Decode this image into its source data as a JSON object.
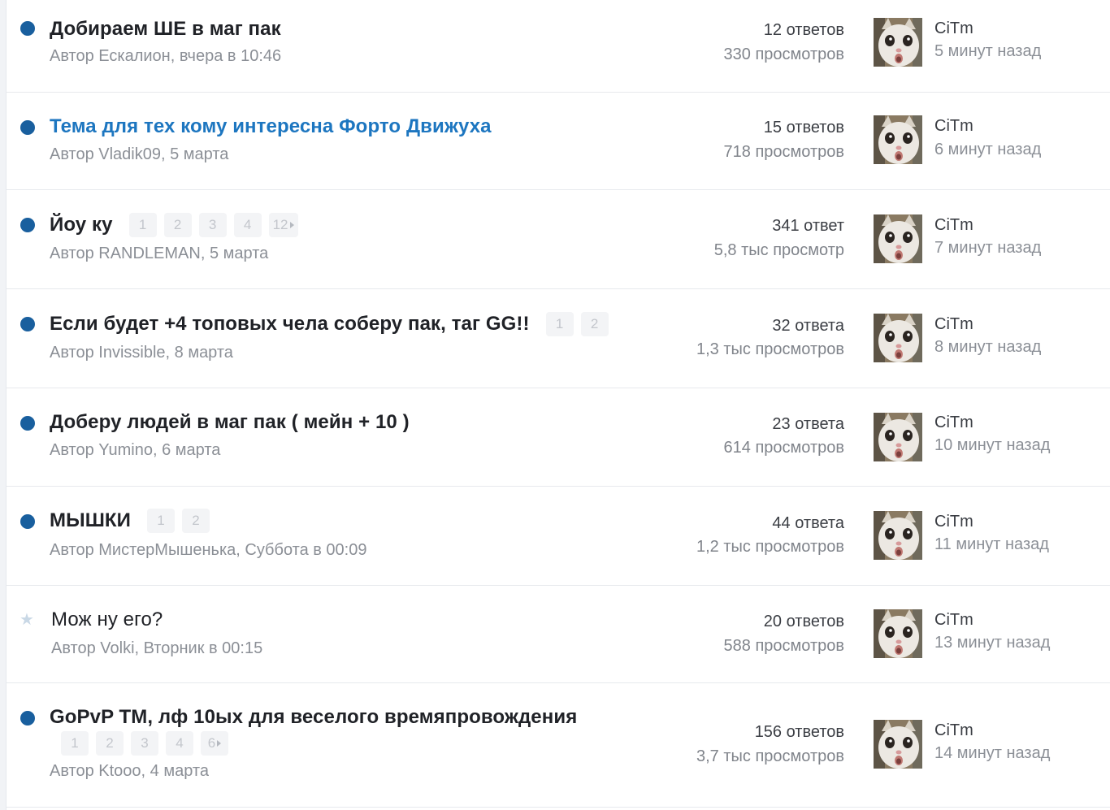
{
  "topics": [
    {
      "title": "Добираем ШЕ в маг пак",
      "author_line": "Автор Ескалион, вчера в 10:46",
      "replies": "12 ответов",
      "views": "330 просмотров",
      "last_user": "CiTm",
      "last_time": "5 минут назад",
      "status": "unread",
      "pages": []
    },
    {
      "title": "Тема для тех кому интересна Форто Движуха",
      "author_line": "Автор Vladik09, 5 марта",
      "replies": "15 ответов",
      "views": "718 просмотров",
      "last_user": "CiTm",
      "last_time": "6 минут назад",
      "status": "unread",
      "pages": []
    },
    {
      "title": "Йоу ку",
      "author_line": "Автор RANDLEMAN, 5 марта",
      "replies": "341 ответ",
      "views": "5,8 тыс просмотр",
      "last_user": "CiTm",
      "last_time": "7 минут назад",
      "status": "unread",
      "pages": [
        "1",
        "2",
        "3",
        "4",
        "12"
      ]
    },
    {
      "title": "Если будет +4 топовых чела соберу пак, таг GG!!",
      "author_line": "Автор Invissible, 8 марта",
      "replies": "32 ответа",
      "views": "1,3 тыс просмотров",
      "last_user": "CiTm",
      "last_time": "8 минут назад",
      "status": "unread",
      "pages": [
        "1",
        "2"
      ]
    },
    {
      "title": "Доберу людей в маг пак ( мейн + 10 )",
      "author_line": "Автор Yumino, 6 марта",
      "replies": "23 ответа",
      "views": "614 просмотров",
      "last_user": "CiTm",
      "last_time": "10 минут назад",
      "status": "unread",
      "pages": []
    },
    {
      "title": "МЫШКИ",
      "author_line": "Автор МистерМышенька, Суббота в 00:09",
      "replies": "44 ответа",
      "views": "1,2 тыс просмотров",
      "last_user": "CiTm",
      "last_time": "11 минут назад",
      "status": "unread",
      "pages": [
        "1",
        "2"
      ]
    },
    {
      "title": "Мож ну его?",
      "author_line": "Автор Volki, Вторник в 00:15",
      "replies": "20 ответов",
      "views": "588 просмотров",
      "last_user": "CiTm",
      "last_time": "13 минут назад",
      "status": "read",
      "pages": []
    },
    {
      "title": "GoPvP TM, лф 10ых для веселого времяпровождения",
      "author_line": "Автор Ktooo, 4 марта",
      "replies": "156 ответов",
      "views": "3,7 тыс просмотров",
      "last_user": "CiTm",
      "last_time": "14 минут назад",
      "status": "unread",
      "pages": [
        "1",
        "2",
        "3",
        "4",
        "6"
      ]
    }
  ],
  "colors": {
    "accent": "#1d76c0",
    "unread_dot": "#195f9e",
    "title": "#202227",
    "muted": "#8b8f96",
    "read_star": "#c9d8e6"
  },
  "icons": {
    "unread": "unread-dot-icon",
    "read": "star-icon",
    "next_page": "caret-right-icon"
  }
}
